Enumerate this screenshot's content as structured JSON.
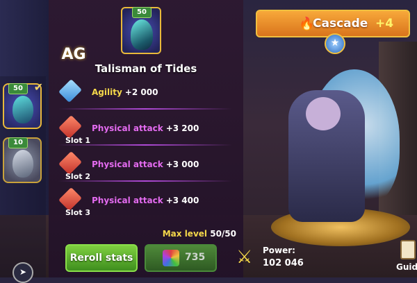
{
  "item": {
    "name": "Talisman of Tides",
    "level_badge": "50",
    "max_level_label": "Max level",
    "max_level_value": "50/50"
  },
  "logo": {
    "text": "AG"
  },
  "side_slots": [
    {
      "level": "50",
      "selected": true,
      "icon": "talisman-blue-icon"
    },
    {
      "level": "10",
      "selected": false,
      "icon": "talisman-grey-icon"
    }
  ],
  "stats": [
    {
      "name": "Agility",
      "value": "+2 000",
      "slot": "",
      "color": "yellow"
    },
    {
      "name": "Physical attack",
      "value": "+3 200",
      "slot": "Slot 1",
      "color": "purple"
    },
    {
      "name": "Physical attack",
      "value": "+3 000",
      "slot": "Slot 2",
      "color": "purple"
    },
    {
      "name": "Physical attack",
      "value": "+3 400",
      "slot": "Slot 3",
      "color": "purple"
    }
  ],
  "buttons": {
    "reroll_label": "Reroll stats",
    "cost_value": "735"
  },
  "hero": {
    "name": "Cascade",
    "plus": "+4",
    "power_label": "Power:",
    "power_value": "102 046"
  },
  "guide": {
    "label": "Guidel"
  },
  "colors": {
    "accent_green": "#7fd040",
    "banner_orange": "#f7a83a",
    "stat_yellow": "#f5d84a",
    "stat_purple": "#e46bf0"
  }
}
